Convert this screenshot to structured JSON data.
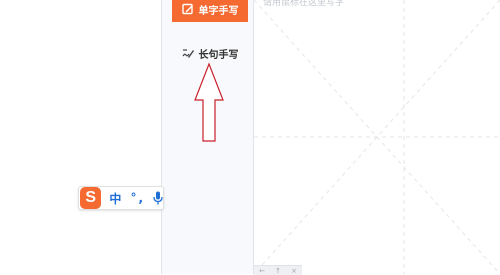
{
  "sidebar": {
    "single_char_label": "单字手写",
    "long_sentence_label": "长句手写",
    "single_char_icon": "edit-pen-icon",
    "long_sentence_icon": "handwriting-icon"
  },
  "canvas": {
    "hint": "请用鼠标在这里写字",
    "bottom_bar_items": [
      "←",
      "↑",
      "×"
    ]
  },
  "annotation": {
    "icon": "up-arrow-icon",
    "color": "#c9202a"
  },
  "ime_bar": {
    "logo": "S",
    "language": "中",
    "punctuation": "°,",
    "icon": "microphone-icon"
  },
  "colors": {
    "accent": "#f46a30",
    "ime_blue": "#1f6fd6",
    "guide_line": "#dcdfe4"
  }
}
